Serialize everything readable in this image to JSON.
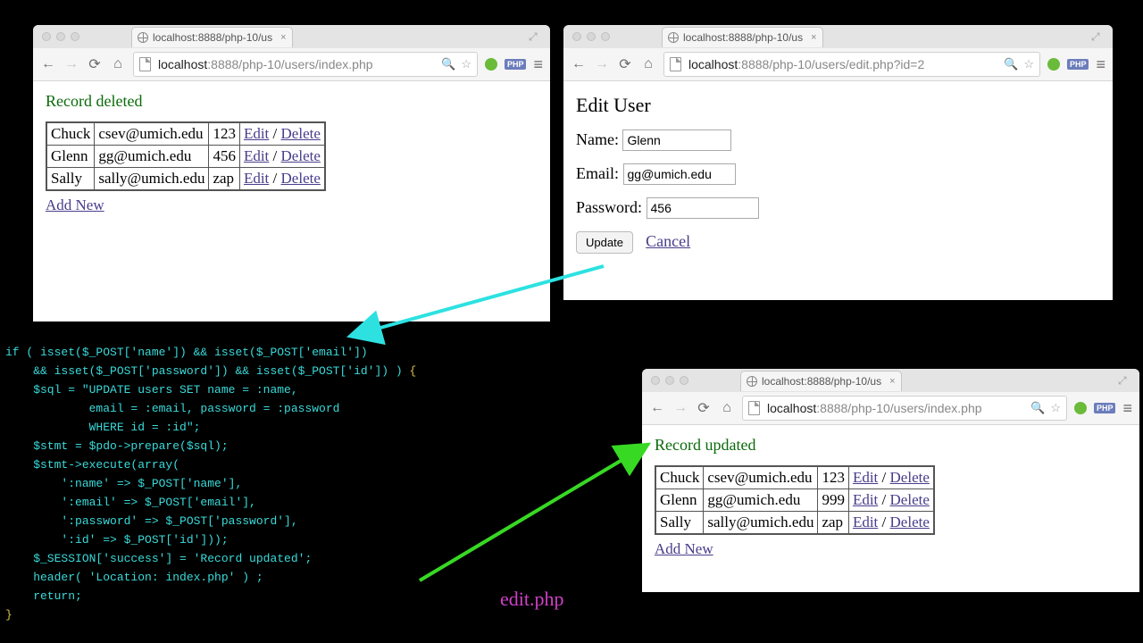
{
  "tab_title": "localhost:8888/php-10/us",
  "window_left": {
    "url_host": "localhost",
    "url_path": ":8888/php-10/users/index.php",
    "status": "Record deleted",
    "rows": [
      {
        "name": "Chuck",
        "email": "csev@umich.edu",
        "pw": "123"
      },
      {
        "name": "Glenn",
        "email": "gg@umich.edu",
        "pw": "456"
      },
      {
        "name": "Sally",
        "email": "sally@umich.edu",
        "pw": "zap"
      }
    ],
    "edit": "Edit",
    "del": "Delete",
    "add": "Add New"
  },
  "window_right": {
    "url_host": "localhost",
    "url_path": ":8888/php-10/users/edit.php?id=2",
    "title": "Edit User",
    "labels": {
      "name": "Name:",
      "email": "Email:",
      "password": "Password:"
    },
    "values": {
      "name": "Glenn",
      "email": "gg@umich.edu",
      "password": "456"
    },
    "update": "Update",
    "cancel": "Cancel"
  },
  "window_bottom": {
    "url_host": "localhost",
    "url_path": ":8888/php-10/users/index.php",
    "status": "Record updated",
    "rows": [
      {
        "name": "Chuck",
        "email": "csev@umich.edu",
        "pw": "123"
      },
      {
        "name": "Glenn",
        "email": "gg@umich.edu",
        "pw": "999"
      },
      {
        "name": "Sally",
        "email": "sally@umich.edu",
        "pw": "zap"
      }
    ],
    "edit": "Edit",
    "del": "Delete",
    "add": "Add New"
  },
  "code": "if ( isset($_POST['name']) && isset($_POST['email'])\n    && isset($_POST['password']) && isset($_POST['id']) ) {\n    $sql = \"UPDATE users SET name = :name,\n            email = :email, password = :password\n            WHERE id = :id\";\n    $stmt = $pdo->prepare($sql);\n    $stmt->execute(array(\n        ':name' => $_POST['name'],\n        ':email' => $_POST['email'],\n        ':password' => $_POST['password'],\n        ':id' => $_POST['id']));\n    $_SESSION['success'] = 'Record updated';\n    header( 'Location: index.php' ) ;\n    return;\n}",
  "label": "edit.php",
  "badge": "PHP"
}
